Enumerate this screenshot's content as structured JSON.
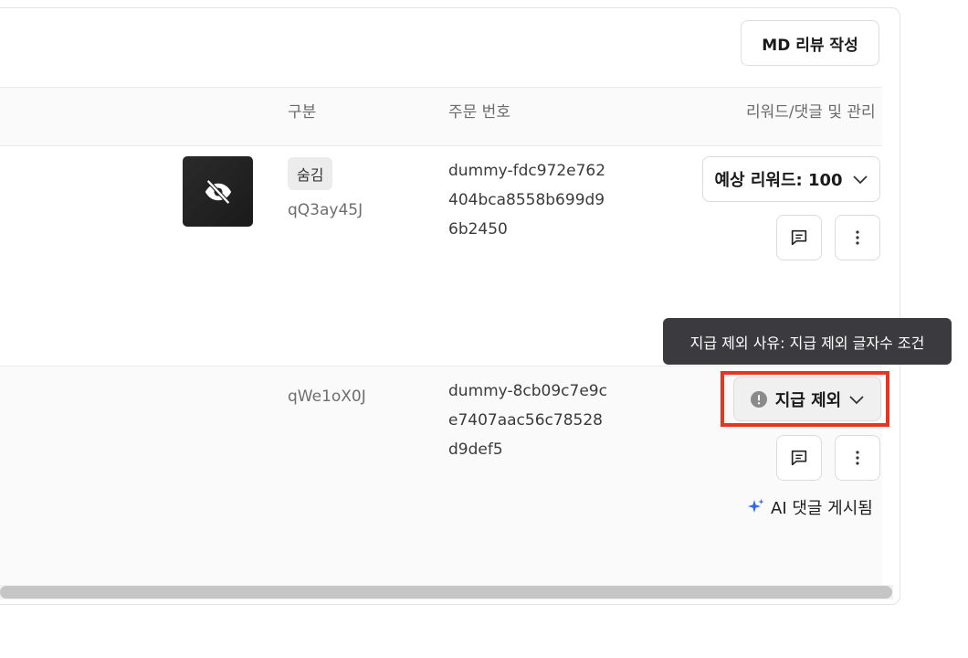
{
  "toolbar": {
    "md_review_button": "MD 리뷰 작성"
  },
  "table": {
    "headers": {
      "type": "구분",
      "order_number": "주문 번호",
      "reward_and_manage": "리워드/댓글 및 관리"
    },
    "rows": [
      {
        "badge": "숨김",
        "code": "qQ3ay45J",
        "order_lines": [
          "dummy-fdc972e762",
          "404bca8558b699d9",
          "6b2450"
        ],
        "reward_select": "예상 리워드: 100"
      },
      {
        "code": "qWe1oX0J",
        "order_lines": [
          "dummy-8cb09c7e9c",
          "e7407aac56c78528",
          "d9def5"
        ],
        "reward_select": "지급 제외",
        "ai_status": "AI 댓글 게시됨"
      }
    ]
  },
  "tooltip": {
    "text": "지급 제외 사유: 지급 제외 글자수 조건"
  },
  "colors": {
    "highlight": "#e8351f",
    "tooltip_bg": "#3b3b3f",
    "ai_sparkle": "#2f6bea"
  }
}
